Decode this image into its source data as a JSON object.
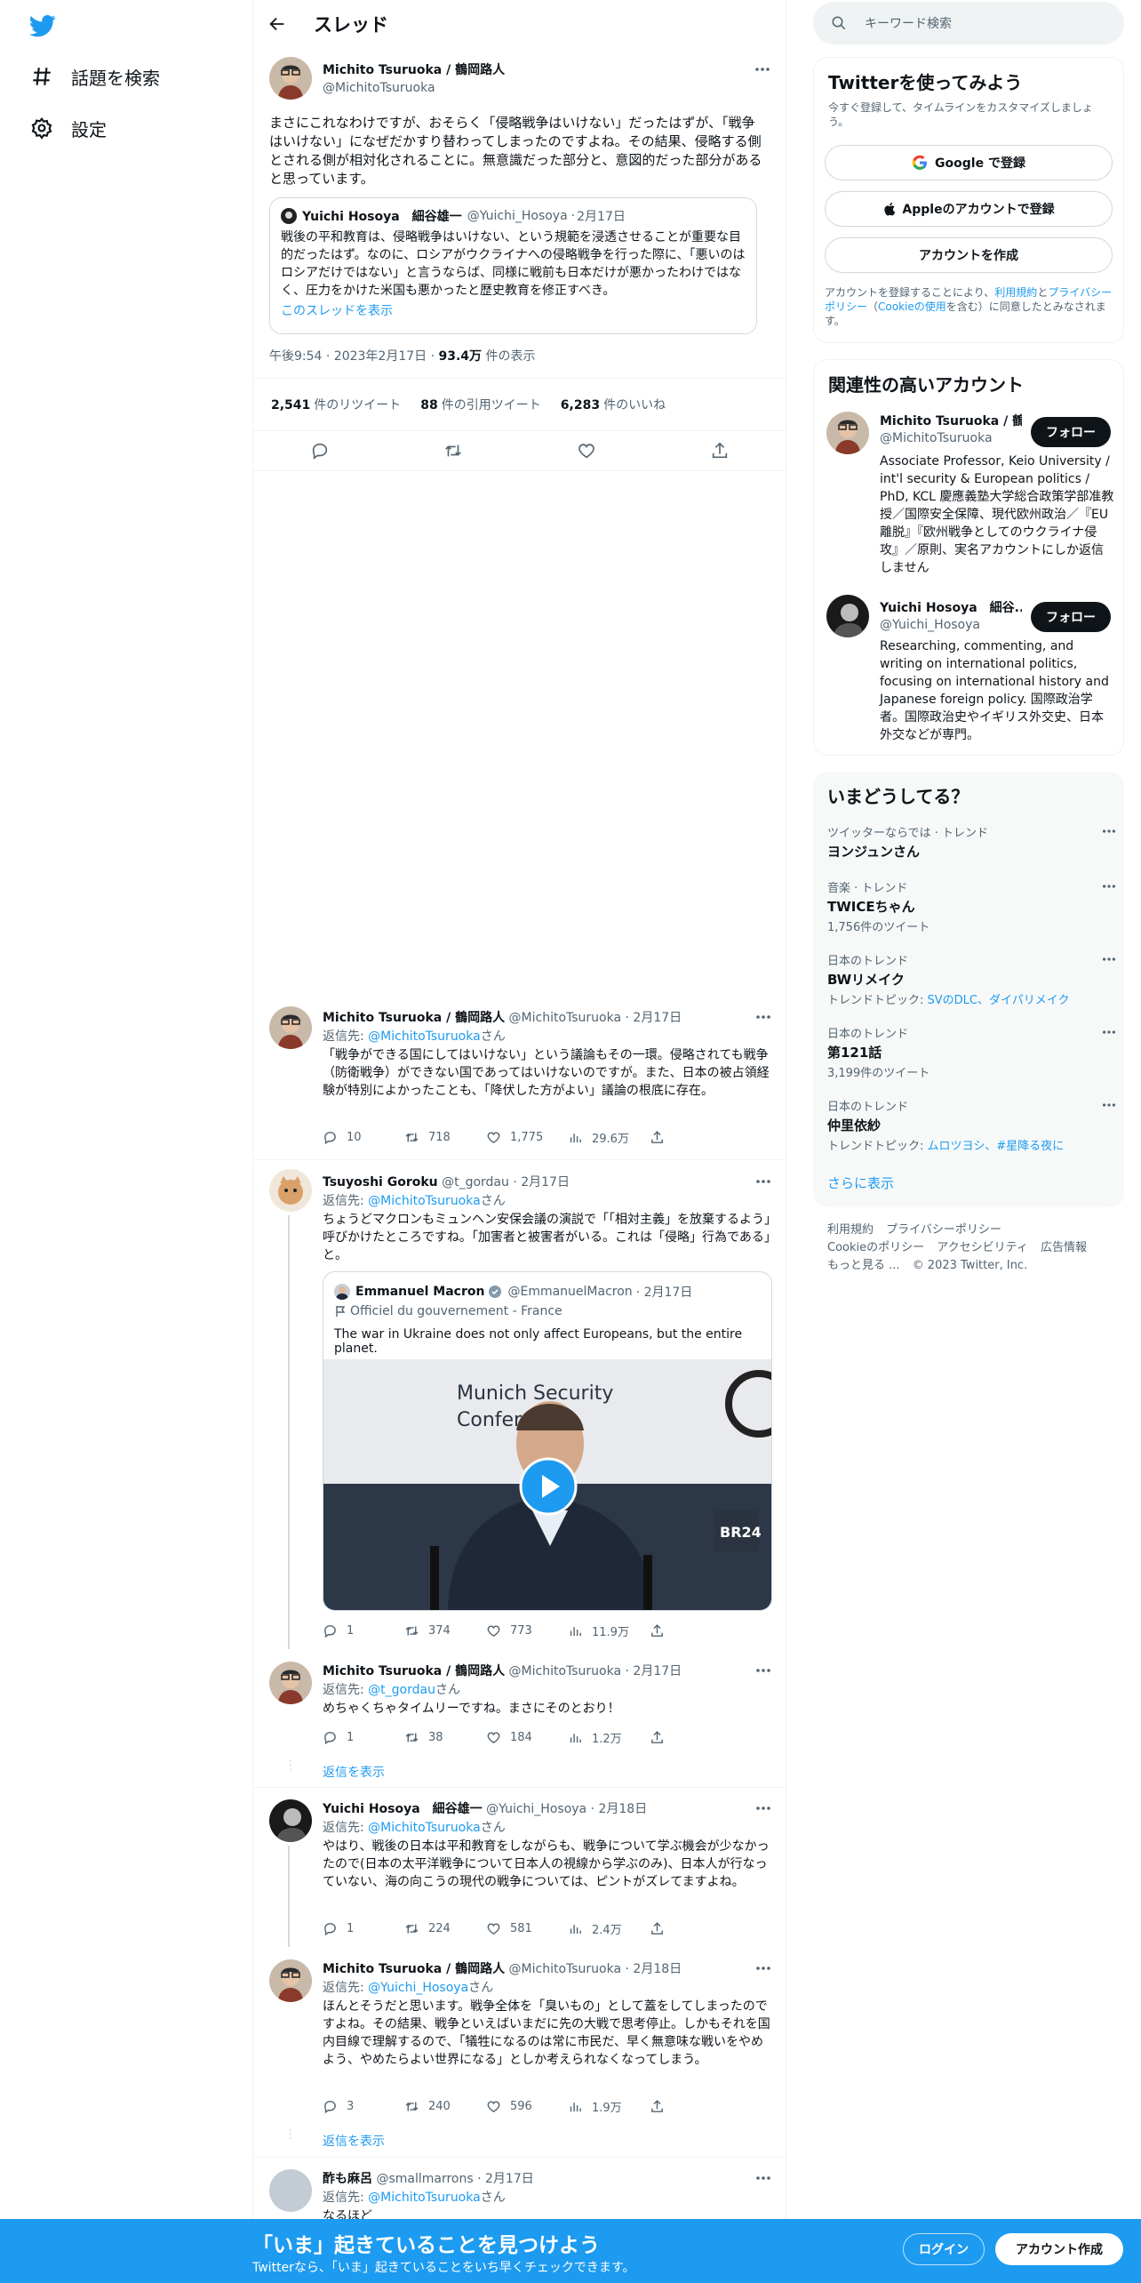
{
  "nav": {
    "explore": "話題を検索",
    "settings": "設定"
  },
  "header": {
    "title": "スレッド"
  },
  "main_tweet": {
    "name": "Michito Tsuruoka / 鶴岡路人",
    "handle": "@MichitoTsuruoka",
    "text": "まさにこれなわけですが、おそらく「侵略戦争はいけない」だったはずが、「戦争はいけない」になぜだかすり替わってしまったのですよね。その結果、侵略する側とされる側が相対化されることに。無意識だった部分と、意図的だった部分があると思っています。",
    "quote": {
      "name": "Yuichi Hosoya　細谷雄一",
      "handle": "@Yuichi_Hosoya",
      "date": "2月17日",
      "text": "戦後の平和教育は、侵略戦争はいけない、という規範を浸透させることが重要な目的だったはず。なのに、ロシアがウクライナへの侵略戦争を行った際に、「悪いのはロシアだけではない」と言うならば、同様に戦前も日本だけが悪かったわけではなく、圧力をかけた米国も悪かったと歴史教育を修正すべき。",
      "show_thread": "このスレッドを表示"
    },
    "time": "午後9:54 · 2023年2月17日 · ",
    "views_num": "93.4万",
    "views_label": " 件の表示",
    "retweets_num": "2,541",
    "retweets_label": "件のリツイート",
    "quotes_num": "88",
    "quotes_label": "件の引用ツイート",
    "likes_num": "6,283",
    "likes_label": "件のいいね"
  },
  "replies": [
    {
      "name": "Michito Tsuruoka / 鶴岡路人",
      "handle": "@MichitoTsuruoka",
      "date": "· 2月17日",
      "reply_prefix": "返信先: ",
      "reply_to": "@MichitoTsuruoka",
      "reply_suffix": "さん",
      "text": "「戦争ができる国にしてはいけない」という議論もその一環。侵略されても戦争（防衛戦争）ができない国であってはいけないのですが。また、日本の被占領経験が特別によかったことも、「降伏した方がよい」議論の根底に存在。",
      "replies": "10",
      "retweets": "718",
      "likes": "1,775",
      "views": "29.6万"
    },
    {
      "name": "Tsuyoshi Goroku",
      "handle": "@t_gordau",
      "date": "· 2月17日",
      "reply_prefix": "返信先: ",
      "reply_to": "@MichitoTsuruoka",
      "reply_suffix": "さん",
      "text": "ちょうどマクロンもミュンヘン安保会議の演説で「「相対主義」を放棄するよう」呼びかけたところですね。「加害者と被害者がいる。これは「侵略」行為である」と。",
      "replies": "1",
      "retweets": "374",
      "likes": "773",
      "views": "11.9万",
      "quote": {
        "name": "Emmanuel Macron",
        "handle": "@EmmanuelMacron",
        "date": "· 2月17日",
        "sub": "Officiel du gouvernement - France",
        "text": "The war in Ukraine does not only affect Europeans, but the entire planet.",
        "video_caption": "Munich Security Conference"
      }
    },
    {
      "name": "Michito Tsuruoka / 鶴岡路人",
      "handle": "@MichitoTsuruoka",
      "date": "· 2月17日",
      "reply_prefix": "返信先: ",
      "reply_to": "@t_gordau",
      "reply_suffix": "さん",
      "text": "めちゃくちゃタイムリーですね。まさにそのとおり！",
      "replies": "1",
      "retweets": "38",
      "likes": "184",
      "views": "1.2万"
    },
    {
      "name": "Yuichi Hosoya　細谷雄一",
      "handle": "@Yuichi_Hosoya",
      "date": "· 2月18日",
      "reply_prefix": "返信先: ",
      "reply_to": "@MichitoTsuruoka",
      "reply_suffix": "さん",
      "text": "やはり、戦後の日本は平和教育をしながらも、戦争について学ぶ機会が少なかったので(日本の太平洋戦争について日本人の視線から学ぶのみ)、日本人が行なっていない、海の向こうの現代の戦争については、ピントがズレてますよね。",
      "replies": "1",
      "retweets": "224",
      "likes": "581",
      "views": "2.4万"
    },
    {
      "name": "Michito Tsuruoka / 鶴岡路人",
      "handle": "@MichitoTsuruoka",
      "date": "· 2月18日",
      "reply_prefix": "返信先: ",
      "reply_to": "@Yuichi_Hosoya",
      "reply_suffix": "さん",
      "text": "ほんとそうだと思います。戦争全体を「臭いもの」として蓋をしてしまったのですよね。その結果、戦争といえばいまだに先の大戦で思考停止。しかもそれを国内目線で理解するので、「犠牲になるのは常に市民だ、早く無意味な戦いをやめよう、やめたらよい世界になる」としか考えられなくなってしまう。",
      "replies": "3",
      "retweets": "240",
      "likes": "596",
      "views": "1.9万"
    },
    {
      "name": "酢も麻呂",
      "handle": "@smallmarrons",
      "date": "· 2月17日",
      "reply_prefix": "返信先: ",
      "reply_to": "@MichitoTsuruoka",
      "reply_suffix": "さん",
      "text": "なるほど"
    }
  ],
  "show_replies": "返信を表示",
  "right": {
    "search_placeholder": "キーワード検索",
    "signup": {
      "title": "Twitterを使ってみよう",
      "subtitle": "今すぐ登録して、タイムラインをカスタマイズしましょう。",
      "google": "Google で登録",
      "apple": "Appleのアカウントで登録",
      "create": "アカウントを作成",
      "terms_1": "アカウントを登録することにより、",
      "terms_link1": "利用規約",
      "terms_2": "と",
      "terms_link2": "プライバシーポリシー",
      "terms_3": "（",
      "terms_link3": "Cookieの使用",
      "terms_4": "を含む）に同意したとみなされます。"
    },
    "relevant": {
      "title": "関連性の高いアカウント",
      "follow": "フォロー",
      "accounts": [
        {
          "name": "Michito Tsuruoka / 鶴...",
          "handle": "@MichitoTsuruoka",
          "bio": "Associate Professor, Keio University / int'l security & European politics / PhD, KCL 慶應義塾大学総合政策学部准教授／国際安全保障、現代欧州政治／『EU離脱』『欧州戦争としてのウクライナ侵攻』／原則、実名アカウントにしか返信しません"
        },
        {
          "name": "Yuichi Hosoya　細谷...",
          "handle": "@Yuichi_Hosoya",
          "bio": "Researching, commenting, and writing on international politics, focusing on international history and Japanese foreign policy. 国際政治学者。国際政治史やイギリス外交史、日本外交などが専門。"
        }
      ]
    },
    "trends": {
      "title": "いまどうしてる？",
      "items": [
        {
          "cat": "ツイッターならでは · トレンド",
          "title": "ヨンジュンさん",
          "sub": ""
        },
        {
          "cat": "音楽 · トレンド",
          "title": "TWICEちゃん",
          "sub": "1,756件のツイート"
        },
        {
          "cat": "日本のトレンド",
          "title": "BWリメイク",
          "sub_prefix": "トレンドトピック: ",
          "sub_links": "SVのDLC、ダイパリメイク"
        },
        {
          "cat": "日本のトレンド",
          "title": "第121話",
          "sub": "3,199件のツイート"
        },
        {
          "cat": "日本のトレンド",
          "title": "仲里依紗",
          "sub_prefix": "トレンドトピック: ",
          "sub_links": "ムロツヨシ、#星降る夜に"
        }
      ],
      "show_more": "さらに表示"
    },
    "footer": {
      "terms": "利用規約",
      "privacy": "プライバシーポリシー",
      "cookie": "Cookieのポリシー",
      "accessibility": "アクセシビリティ",
      "ads": "広告情報",
      "more": "もっと見る ...",
      "copyright": "© 2023 Twitter, Inc."
    }
  },
  "bottombar": {
    "title": "「いま」起きていることを見つけよう",
    "subtitle": "Twitterなら、「いま」起きていることをいち早くチェックできます。",
    "login": "ログイン",
    "signup": "アカウント作成"
  },
  "colors": {
    "accent": "#1d9bf0",
    "text": "#0f1419",
    "muted": "#536471"
  }
}
